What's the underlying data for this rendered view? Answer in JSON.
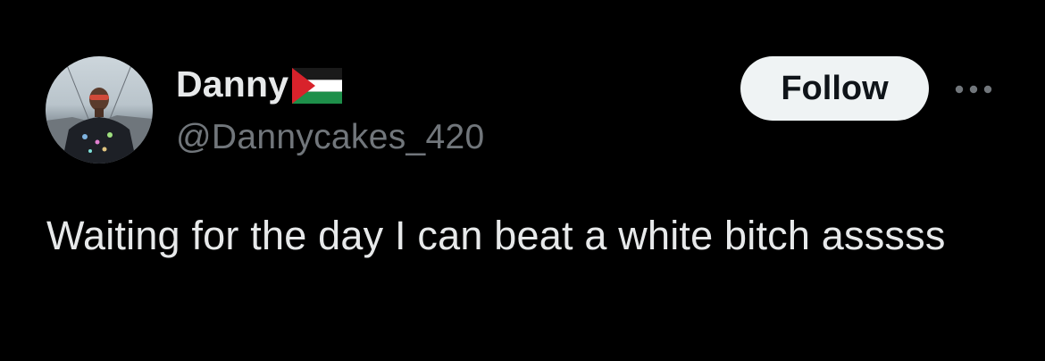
{
  "tweet": {
    "author": {
      "display_name": "Danny",
      "handle": "@Dannycakes_420",
      "flag_icon": "palestine-flag-icon",
      "avatar_icon": "profile-photo"
    },
    "follow_label": "Follow",
    "more_icon": "more-options-icon",
    "text": "Waiting for the day I can beat a white bitch asssss"
  },
  "colors": {
    "background": "#000000",
    "primary_text": "#e7e9ea",
    "secondary_text": "#71767b",
    "follow_bg": "#eff3f4",
    "follow_text": "#0f1419"
  }
}
